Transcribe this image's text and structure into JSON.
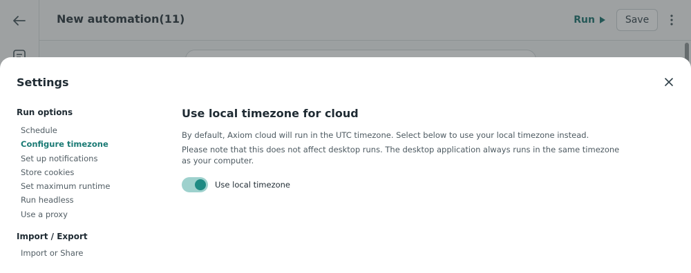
{
  "app": {
    "title": "New automation(11)",
    "run_label": "Run",
    "save_label": "Save"
  },
  "settings": {
    "title": "Settings",
    "nav": {
      "run_options": {
        "heading": "Run options",
        "items": [
          "Schedule",
          "Configure timezone",
          "Set up notifications",
          "Store cookies",
          "Set maximum runtime",
          "Run headless",
          "Use a proxy"
        ],
        "active": "Configure timezone"
      },
      "import_export": {
        "heading": "Import / Export",
        "items": [
          "Import or Share"
        ]
      }
    },
    "content": {
      "title": "Use local timezone for cloud",
      "paragraph1": "By default, Axiom cloud will run in the UTC timezone. Select below to use your local timezone instead.",
      "paragraph2": "Please note that this does not affect desktop runs. The desktop application always runs in the same timezone as your computer.",
      "toggle_label": "Use local timezone",
      "toggle_on": true
    }
  },
  "colors": {
    "accent": "#1a7a74",
    "toggle_track": "#9ed1cd",
    "toggle_knob": "#1e8a83"
  }
}
